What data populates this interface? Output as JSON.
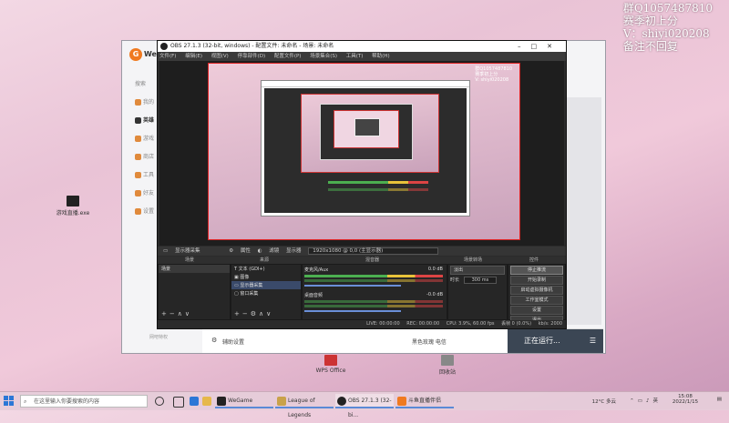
{
  "desktop": {
    "overlay_lines": [
      "群Q1057487810",
      "赛季初上分",
      "V：shiyi020208",
      "备注不回复"
    ],
    "icons": [
      {
        "label": "游戏直播.exe"
      },
      {
        "label": "WPS Office"
      },
      {
        "label": "回收站"
      }
    ]
  },
  "wegame": {
    "brand": "WeGame",
    "nav": [
      "搜索",
      "我的",
      "英雄",
      "游戏",
      "商店",
      "工具",
      "好友",
      "设置"
    ],
    "bottom_left": "辅助设置",
    "bottom_status": "黑色玫瑰 电信",
    "running_label": "正在运行...",
    "footer_small": "网吧特权"
  },
  "obs": {
    "title": "OBS 27.1.3 (32-bit, windows) - 配置文件: 未命名 - 场景: 未命名",
    "menu": [
      "文件(F)",
      "编辑(E)",
      "视图(V)",
      "停靠部件(D)",
      "配置文件(P)",
      "场景集合(S)",
      "工具(T)",
      "帮助(H)"
    ],
    "canvas_overlay": [
      "群Q1057487810",
      "赛季初上分",
      "V: shiyi020208"
    ],
    "source_toolbar": [
      "显示器采集",
      "属性",
      "滤镜",
      "显示器",
      "1920x1080 @ 0,0 (主显示器)"
    ],
    "docks": {
      "scenes_title": "场景",
      "sources_title": "来源",
      "mixer_title": "混音器",
      "transitions_title": "场景转场",
      "controls_title": "控件"
    },
    "scenes": [
      "场景"
    ],
    "sources": [
      {
        "name": "文本 (GDI+)",
        "selected": false
      },
      {
        "name": "图像",
        "selected": false
      },
      {
        "name": "显示器采集",
        "selected": true
      },
      {
        "name": "窗口采集",
        "selected": false
      }
    ],
    "mixer": [
      {
        "name": "麦克风/Aux",
        "db": "0.0 dB"
      },
      {
        "name": "桌面音频",
        "db": "-0.0 dB"
      }
    ],
    "transition": {
      "type": "淡出",
      "duration_label": "时长",
      "duration": "300 ms"
    },
    "controls": [
      "停止推流",
      "开始录制",
      "启动虚拟摄像机",
      "工作室模式",
      "设置",
      "退出"
    ],
    "status": [
      "LIVE: 00:00:00",
      "REC: 00:00:00",
      "CPU: 3.9%, 60.00 fps",
      "丢帧 0 (0.0%)",
      "kb/s: 2000"
    ]
  },
  "taskbar": {
    "search_placeholder": "在这里输入你要搜索的内容",
    "tasks": [
      "WeGame",
      "League of Legends",
      "OBS 27.1.3 (32-bi...",
      "斗鱼直播伴侣"
    ],
    "weather": "12°C 多云",
    "time": "15:08",
    "date": "2022/1/15"
  }
}
